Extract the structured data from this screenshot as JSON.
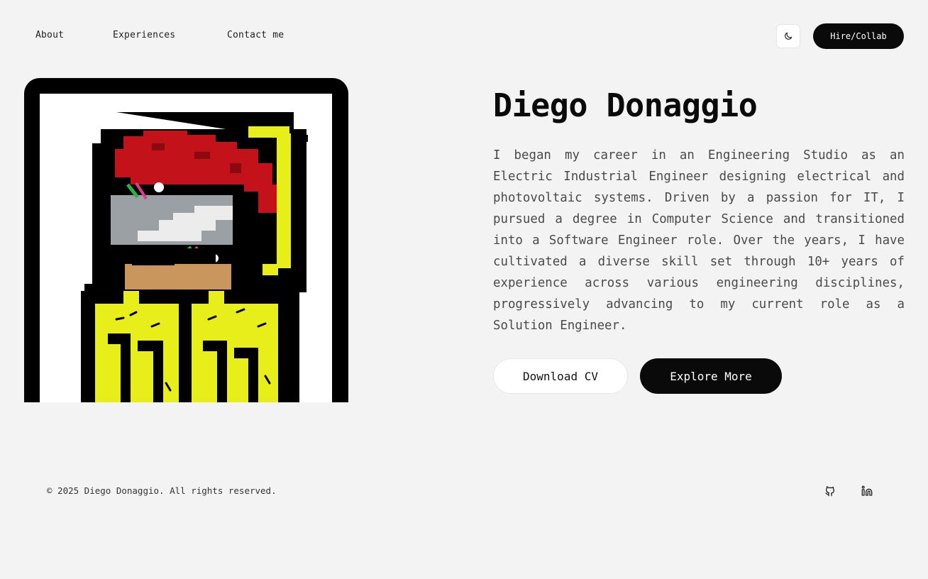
{
  "nav": {
    "links": [
      "About",
      "Experiences",
      "Contact me"
    ],
    "theme_icon": "moon-icon",
    "hire_label": "Hire/Collab"
  },
  "hero": {
    "name": "Diego Donaggio",
    "bio": "I began my career in an Engineering Studio as an Electric Industrial Engineer designing electrical and photovoltaic systems. Driven by a passion for IT, I pursued a degree in Computer Science and transitioned into a Software Engineer role. Over the years, I have cultivated a diverse skill set through 10+ years of experience across various engineering disciplines, progressively advancing to my current role as a Solution Engineer.",
    "download_label": "Download CV",
    "explore_label": "Explore More"
  },
  "footer": {
    "copyright": "© 2025 Diego Donaggio. All rights reserved.",
    "social_icons": [
      "github-icon",
      "linkedin-icon"
    ]
  },
  "colors": {
    "background": "#f3f3f3",
    "primary": "#0a0a0a",
    "text_muted": "#4a4a4a",
    "avatar_hair": "#c4121a",
    "avatar_shirt": "#e8ee1a"
  }
}
